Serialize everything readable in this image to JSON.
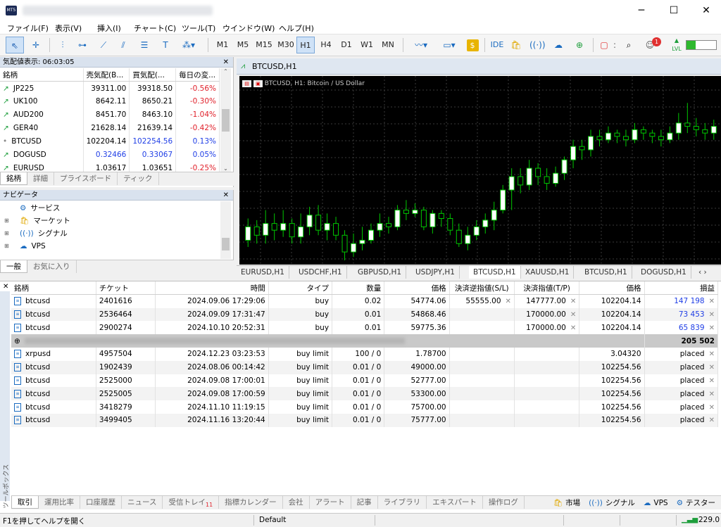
{
  "window": {
    "controls": {
      "minimize": "─",
      "maximize": "☐",
      "close": "✕"
    }
  },
  "menu": [
    "ファイル(F)",
    "表示(V)",
    "挿入(I)",
    "チャート(C)",
    "ツール(T)",
    "ウインドウ(W)",
    "ヘルプ(H)"
  ],
  "toolbar": {
    "timeframes": [
      "M1",
      "M5",
      "M15",
      "M30",
      "H1",
      "H4",
      "D1",
      "W1",
      "MN"
    ],
    "active_timeframe": "H1",
    "ide": "IDE",
    "notification_count": "1",
    "lvl": "LVL"
  },
  "market_watch": {
    "title": "気配値表示: 06:03:05",
    "columns": [
      "銘柄",
      "売気配(B...",
      "買気配(...",
      "毎日の変..."
    ],
    "rows": [
      {
        "symbol": "JP225",
        "bid": "39311.00",
        "ask": "39318.50",
        "change": "-0.56%",
        "dir": "up"
      },
      {
        "symbol": "UK100",
        "bid": "8642.11",
        "ask": "8650.21",
        "change": "-0.30%",
        "dir": "up"
      },
      {
        "symbol": "AUD200",
        "bid": "8451.70",
        "ask": "8463.10",
        "change": "-1.04%",
        "dir": "up"
      },
      {
        "symbol": "GER40",
        "bid": "21628.14",
        "ask": "21639.14",
        "change": "-0.42%",
        "dir": "up"
      },
      {
        "symbol": "BTCUSD",
        "bid": "102204.14",
        "ask": "102254.56",
        "change": "0.13%",
        "dir": "dot"
      },
      {
        "symbol": "DOGUSD",
        "bid": "0.32466",
        "ask": "0.33067",
        "change": "0.05%",
        "dir": "up"
      },
      {
        "symbol": "EURUSD",
        "bid": "1.03617",
        "ask": "1.03651",
        "change": "-0.25%",
        "dir": "up"
      }
    ],
    "tabs": [
      "銘柄",
      "詳細",
      "プライスボード",
      "ティック"
    ]
  },
  "navigator": {
    "title": "ナビゲータ",
    "items": [
      "サービス",
      "マーケット",
      "シグナル",
      "VPS"
    ],
    "tabs": [
      "一般",
      "お気に入り"
    ]
  },
  "chart": {
    "window_title": "BTCUSD,H1",
    "info": "BTCUSD, H1:  Bitcoin / US Dollar",
    "tabs": [
      "EURUSD,H1",
      "USDCHF,H1",
      "GBPUSD,H1",
      "USDJPY,H1",
      "BTCUSD,H1",
      "XAUUSD,H1",
      "BTCUSD,H1",
      "DOGUSD,H1"
    ],
    "bull_color": "#ffffff",
    "bear_color": "#000000",
    "wick_color": "#00c800",
    "grid_color": "#3a3a3a",
    "candles": [
      [
        0.12,
        0.2,
        0.08,
        0.25
      ],
      [
        0.2,
        0.15,
        0.1,
        0.24
      ],
      [
        0.15,
        0.22,
        0.1,
        0.3
      ],
      [
        0.22,
        0.18,
        0.12,
        0.28
      ],
      [
        0.18,
        0.22,
        0.14,
        0.3
      ],
      [
        0.22,
        0.14,
        0.1,
        0.25
      ],
      [
        0.14,
        0.2,
        0.1,
        0.28
      ],
      [
        0.2,
        0.27,
        0.15,
        0.32
      ],
      [
        0.27,
        0.18,
        0.15,
        0.33
      ],
      [
        0.18,
        0.22,
        0.12,
        0.28
      ],
      [
        0.22,
        0.15,
        0.12,
        0.26
      ],
      [
        0.15,
        0.05,
        0.0,
        0.18
      ],
      [
        0.05,
        0.1,
        0.02,
        0.16
      ],
      [
        0.1,
        0.12,
        0.06,
        0.2
      ],
      [
        0.12,
        0.18,
        0.1,
        0.22
      ],
      [
        0.18,
        0.22,
        0.14,
        0.28
      ],
      [
        0.22,
        0.2,
        0.16,
        0.26
      ],
      [
        0.2,
        0.3,
        0.18,
        0.33
      ],
      [
        0.3,
        0.28,
        0.24,
        0.36
      ],
      [
        0.28,
        0.3,
        0.26,
        0.34
      ],
      [
        0.3,
        0.2,
        0.18,
        0.32
      ],
      [
        0.2,
        0.28,
        0.16,
        0.3
      ],
      [
        0.28,
        0.25,
        0.2,
        0.3
      ],
      [
        0.25,
        0.18,
        0.15,
        0.28
      ],
      [
        0.18,
        0.1,
        0.08,
        0.22
      ],
      [
        0.1,
        0.15,
        0.06,
        0.2
      ],
      [
        0.15,
        0.2,
        0.12,
        0.24
      ],
      [
        0.2,
        0.24,
        0.16,
        0.28
      ],
      [
        0.24,
        0.3,
        0.18,
        0.35
      ],
      [
        0.3,
        0.42,
        0.28,
        0.45
      ],
      [
        0.42,
        0.5,
        0.3,
        0.55
      ],
      [
        0.5,
        0.45,
        0.4,
        0.55
      ],
      [
        0.45,
        0.55,
        0.42,
        0.6
      ],
      [
        0.55,
        0.5,
        0.45,
        0.58
      ],
      [
        0.5,
        0.46,
        0.42,
        0.55
      ],
      [
        0.46,
        0.52,
        0.44,
        0.56
      ],
      [
        0.52,
        0.6,
        0.48,
        0.62
      ],
      [
        0.6,
        0.68,
        0.55,
        0.72
      ],
      [
        0.68,
        0.66,
        0.6,
        0.72
      ],
      [
        0.66,
        0.74,
        0.62,
        0.78
      ],
      [
        0.74,
        0.72,
        0.68,
        0.78
      ],
      [
        0.72,
        0.76,
        0.7,
        0.8
      ],
      [
        0.76,
        0.74,
        0.7,
        0.78
      ],
      [
        0.74,
        0.72,
        0.68,
        0.78
      ],
      [
        0.72,
        0.78,
        0.7,
        0.82
      ],
      [
        0.78,
        0.76,
        0.72,
        0.8
      ],
      [
        0.76,
        0.74,
        0.7,
        0.78
      ],
      [
        0.74,
        0.72,
        0.68,
        0.78
      ],
      [
        0.72,
        0.76,
        0.7,
        0.8
      ],
      [
        0.76,
        0.82,
        0.72,
        0.88
      ],
      [
        0.82,
        0.8,
        0.76,
        0.94
      ],
      [
        0.8,
        0.78,
        0.74,
        0.85
      ],
      [
        0.78,
        0.76,
        0.72,
        0.82
      ],
      [
        0.76,
        0.8,
        0.72,
        0.84
      ]
    ]
  },
  "trade": {
    "columns": [
      "銘柄",
      "チケット",
      "時間",
      "タイプ",
      "数量",
      "価格",
      "決済逆指値(S/L)",
      "決済指値(T/P)",
      "価格",
      "損益"
    ],
    "positions": [
      {
        "symbol": "btcusd",
        "ticket": "2401616",
        "time": "2024.09.06 17:29:06",
        "type": "buy",
        "volume": "0.02",
        "price": "54774.06",
        "sl": "55555.00",
        "tp": "147777.00",
        "current": "102204.14",
        "profit": "147 198"
      },
      {
        "symbol": "btcusd",
        "ticket": "2536464",
        "time": "2024.09.09 17:31:47",
        "type": "buy",
        "volume": "0.01",
        "price": "54868.46",
        "sl": "",
        "tp": "170000.00",
        "current": "102204.14",
        "profit": "73 453"
      },
      {
        "symbol": "btcusd",
        "ticket": "2900274",
        "time": "2024.10.10 20:52:31",
        "type": "buy",
        "volume": "0.01",
        "price": "59775.36",
        "sl": "",
        "tp": "170000.00",
        "current": "102204.14",
        "profit": "65 839"
      }
    ],
    "total": "205 502",
    "orders": [
      {
        "symbol": "xrpusd",
        "ticket": "4957504",
        "time": "2024.12.23 03:23:53",
        "type": "buy limit",
        "volume": "100 / 0",
        "price": "1.78700",
        "current": "3.04320",
        "status": "placed"
      },
      {
        "symbol": "btcusd",
        "ticket": "1902439",
        "time": "2024.08.06 00:14:42",
        "type": "buy limit",
        "volume": "0.01 / 0",
        "price": "49000.00",
        "current": "102254.56",
        "status": "placed"
      },
      {
        "symbol": "btcusd",
        "ticket": "2525000",
        "time": "2024.09.08 17:00:01",
        "type": "buy limit",
        "volume": "0.01 / 0",
        "price": "52777.00",
        "current": "102254.56",
        "status": "placed"
      },
      {
        "symbol": "btcusd",
        "ticket": "2525005",
        "time": "2024.09.08 17:00:59",
        "type": "buy limit",
        "volume": "0.01 / 0",
        "price": "53300.00",
        "current": "102254.56",
        "status": "placed"
      },
      {
        "symbol": "btcusd",
        "ticket": "3418279",
        "time": "2024.11.10 11:19:15",
        "type": "buy limit",
        "volume": "0.01 / 0",
        "price": "75700.00",
        "current": "102254.56",
        "status": "placed"
      },
      {
        "symbol": "btcusd",
        "ticket": "3499405",
        "time": "2024.11.16 13:20:44",
        "type": "buy limit",
        "volume": "0.01 / 0",
        "price": "75777.00",
        "current": "102254.56",
        "status": "placed"
      }
    ],
    "side_label": "ツールボックス",
    "tabs": [
      "取引",
      "運用比率",
      "口座履歴",
      "ニュース",
      "受信トレイ",
      "指標カレンダー",
      "会社",
      "アラート",
      "記事",
      "ライブラリ",
      "エキスパート",
      "操作ログ"
    ],
    "inbox_count": "11",
    "right_tabs": [
      "市場",
      "シグナル",
      "VPS",
      "テスター"
    ]
  },
  "status": {
    "help": "F1を押してヘルプを開く",
    "profile": "Default",
    "speed": "229.0"
  }
}
